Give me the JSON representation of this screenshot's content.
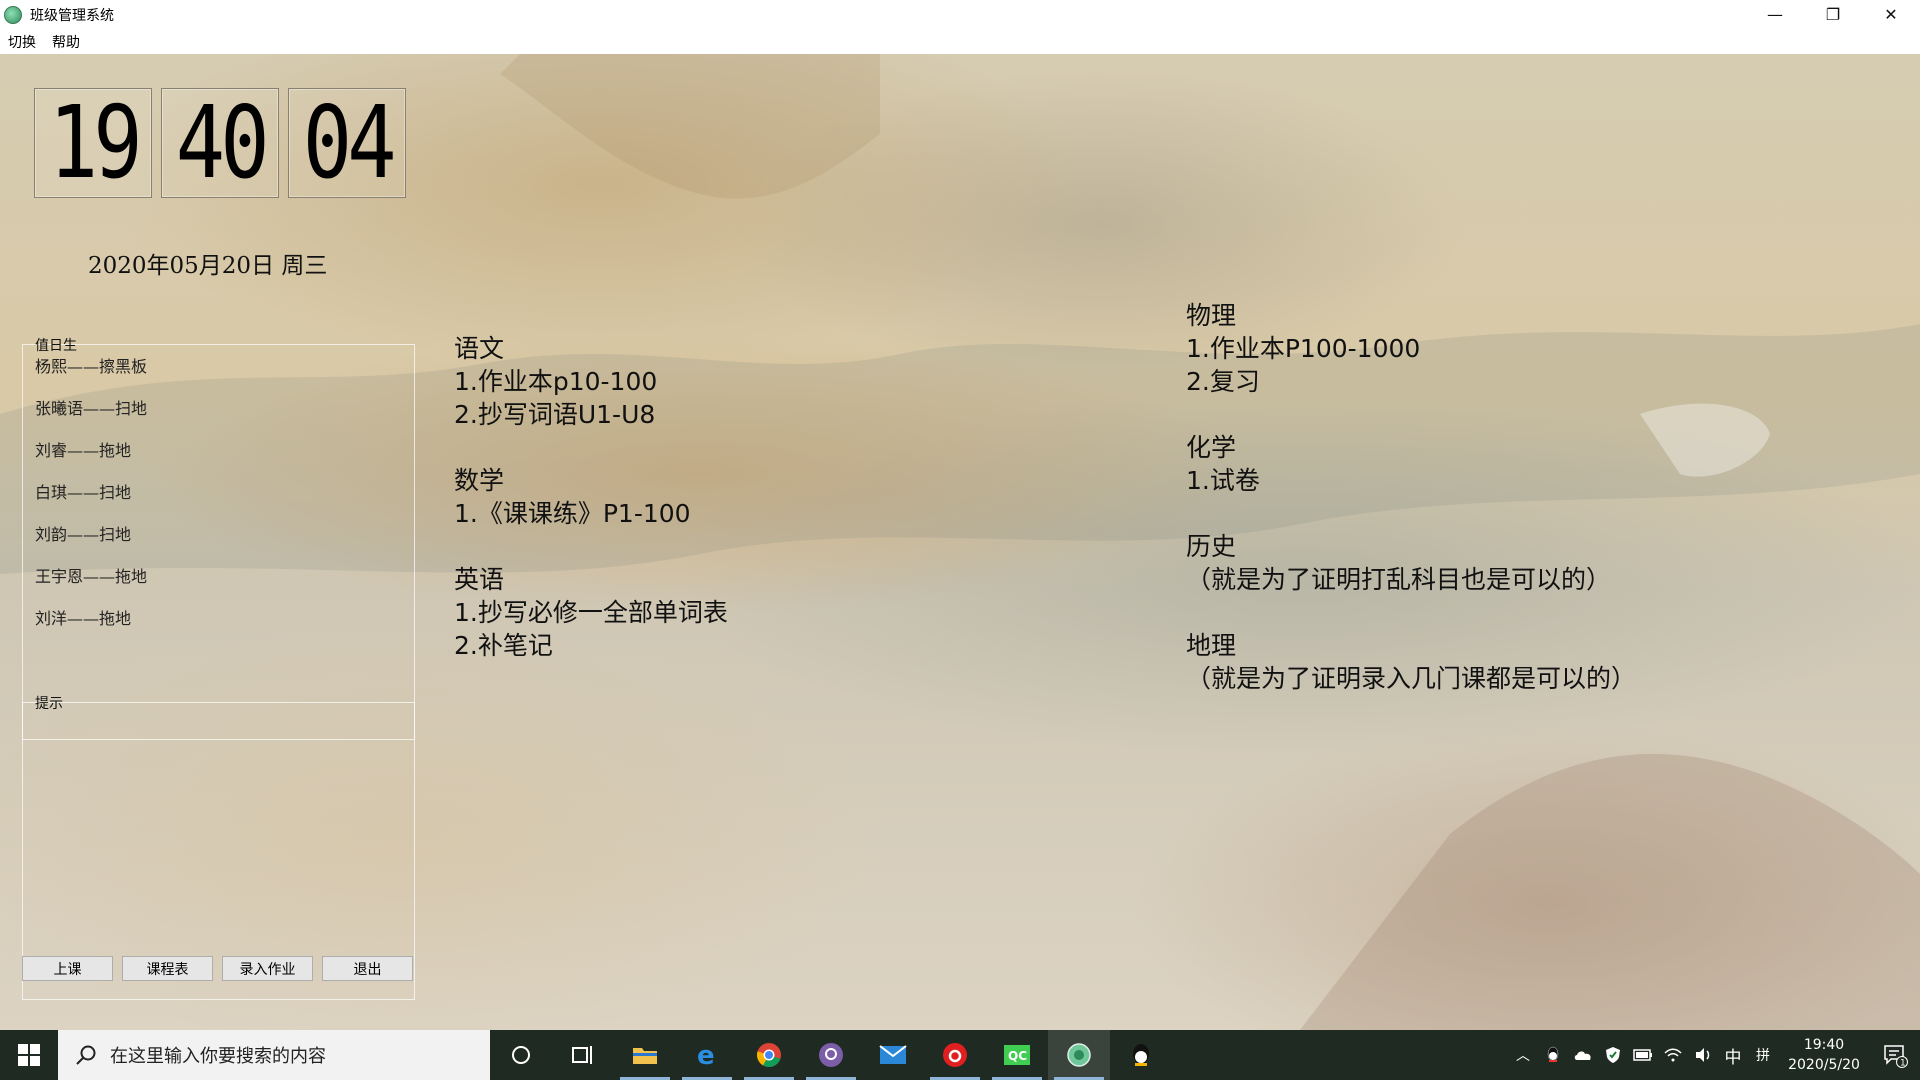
{
  "window": {
    "title": "班级管理系统",
    "controls": {
      "minimize": "—",
      "maximize": "❐",
      "close": "✕"
    }
  },
  "menu": {
    "items": [
      "切换",
      "帮助"
    ]
  },
  "clock": {
    "hours": "19",
    "minutes": "40",
    "seconds": "04"
  },
  "date": {
    "text": "2020年05月20日  周三"
  },
  "duty": {
    "title": "值日生",
    "items": [
      "杨熙——擦黑板",
      "张曦语——扫地",
      "刘睿——拖地",
      "白琪——扫地",
      "刘韵——扫地",
      "王宇恩——拖地",
      "刘洋——拖地"
    ]
  },
  "tips": {
    "title": "提示"
  },
  "buttons": {
    "class_label": "上课",
    "schedule_label": "课程表",
    "homework_label": "录入作业",
    "exit_label": "退出"
  },
  "homework": {
    "left": [
      {
        "subject": "语文",
        "lines": [
          "1.作业本p10-100",
          "2.抄写词语U1-U8"
        ]
      },
      {
        "subject": "数学",
        "lines": [
          "1.《课课练》P1-100"
        ]
      },
      {
        "subject": "英语",
        "lines": [
          "1.抄写必修一全部单词表",
          "2.补笔记"
        ]
      }
    ],
    "right": [
      {
        "subject": "物理",
        "lines": [
          "1.作业本P100-1000",
          "2.复习"
        ]
      },
      {
        "subject": "化学",
        "lines": [
          "1.试卷"
        ]
      },
      {
        "subject": "历史",
        "lines": [
          "（就是为了证明打乱科目也是可以的）"
        ]
      },
      {
        "subject": "地理",
        "lines": [
          "（就是为了证明录入几门课都是可以的）"
        ]
      }
    ]
  },
  "taskbar": {
    "search_placeholder": "在这里输入你要搜索的内容",
    "ime": "中",
    "ime_layout": "拼",
    "time": "19:40",
    "date": "2020/5/20",
    "notification_count": "1"
  },
  "colors": {
    "taskbar": "#1f2a22",
    "search_bg": "#f2f2f2",
    "button_bg": "#e6e6e6"
  }
}
